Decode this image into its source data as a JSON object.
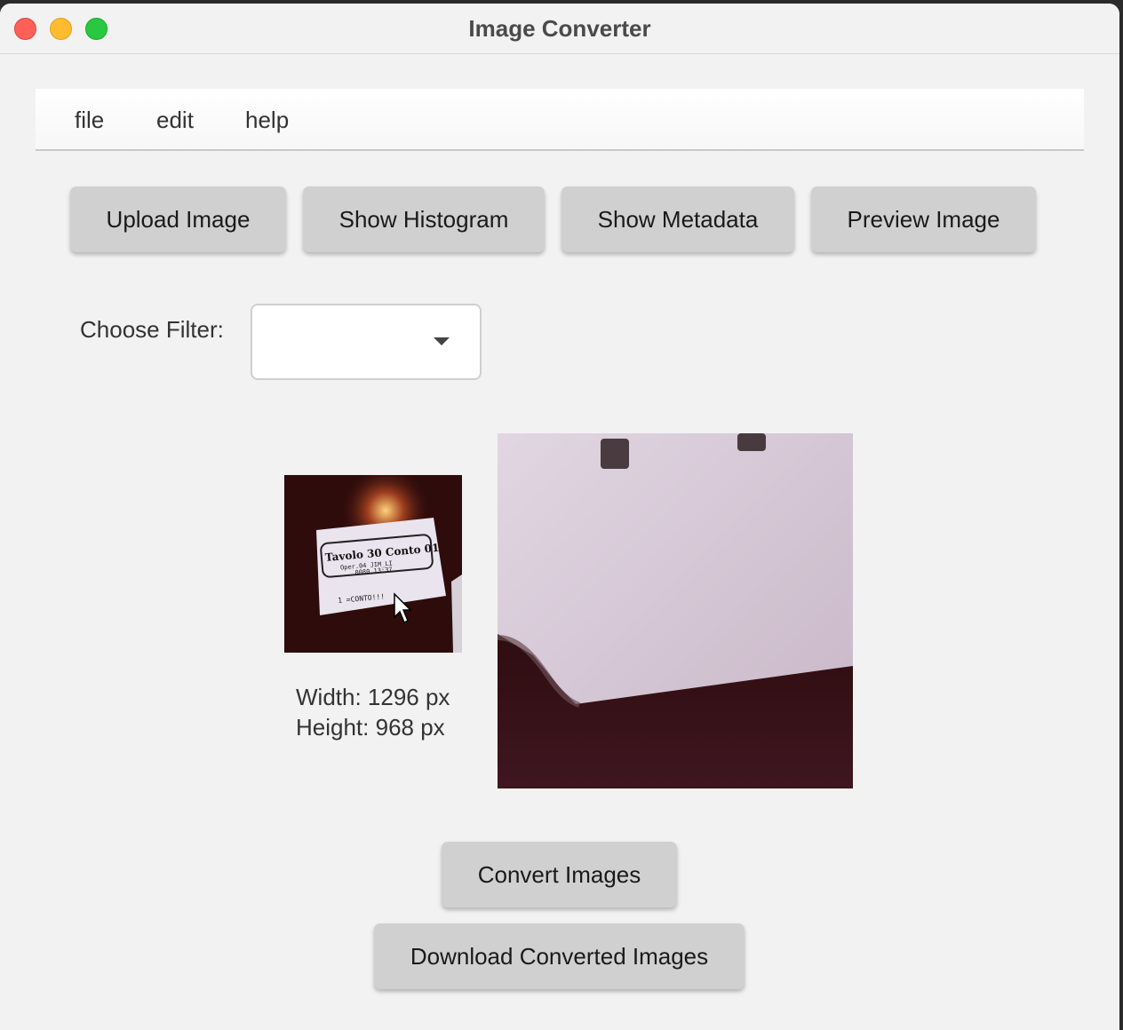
{
  "window": {
    "title": "Image Converter"
  },
  "menu": {
    "items": [
      "file",
      "edit",
      "help"
    ]
  },
  "toolbar": {
    "upload": "Upload Image",
    "histogram": "Show Histogram",
    "metadata": "Show Metadata",
    "preview": "Preview Image"
  },
  "filter": {
    "label": "Choose Filter:",
    "selected": ""
  },
  "image_info": {
    "width": "Width: 1296 px",
    "height": "Height: 968 px"
  },
  "thumbnail_text": {
    "line1": "Tavolo 30  Conto 01",
    "line2": "Oper.04 JIM_LI",
    "line3": "0080   13:37",
    "line4": "1 =CONTO!!!"
  },
  "actions": {
    "convert": "Convert Images",
    "download": "Download Converted Images"
  },
  "colors": {
    "button_bg": "#d0d0d0",
    "window_bg": "#f2f2f2"
  }
}
